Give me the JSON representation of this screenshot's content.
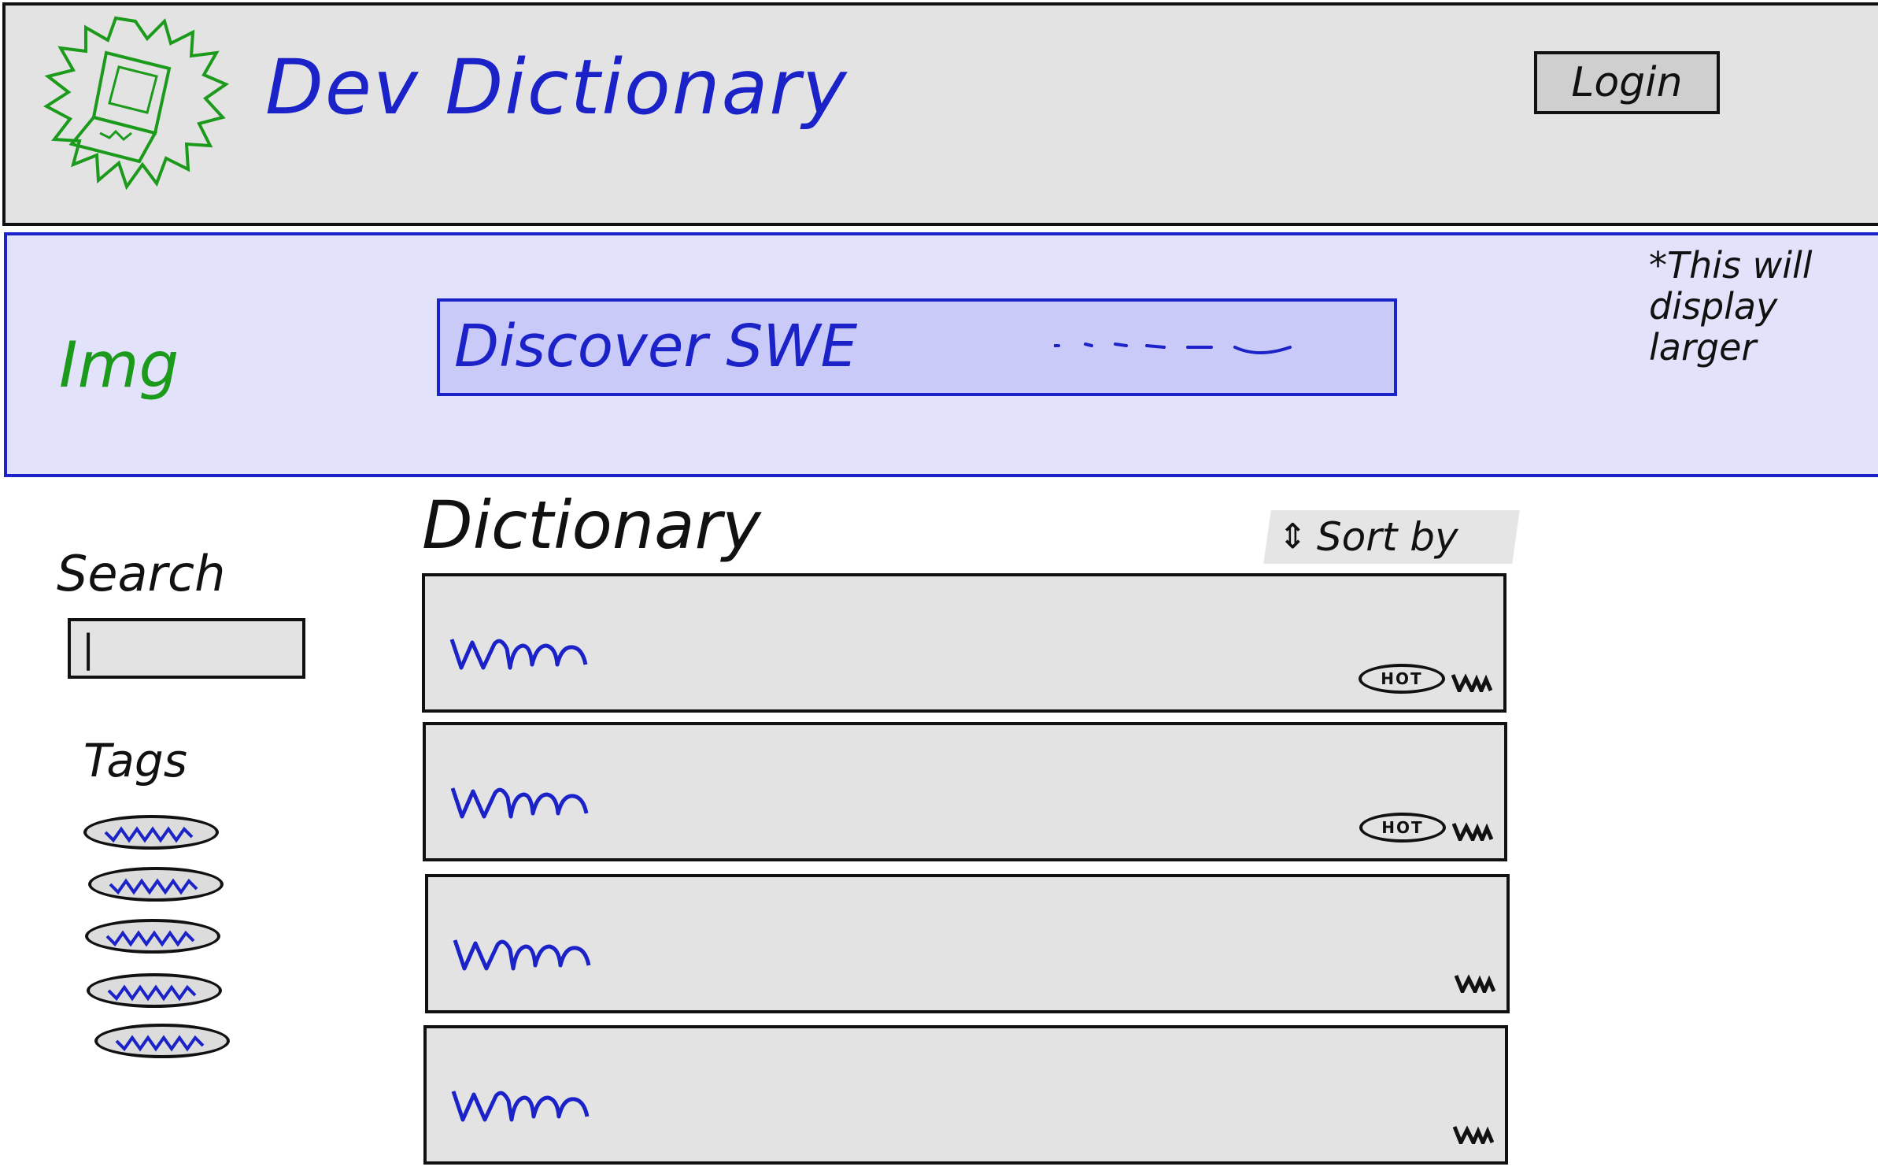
{
  "header": {
    "title": "Dev Dictionary",
    "login_label": "Login"
  },
  "banner": {
    "image_placeholder": "Img",
    "search_text": "Discover SWE",
    "note": "*This will display larger"
  },
  "sidebar": {
    "search_label": "Search",
    "search_value": "|",
    "tags_label": "Tags",
    "tag_count": 5
  },
  "main": {
    "title": "Dictionary",
    "sort_label": "Sort by",
    "entries": [
      {
        "hot": true,
        "badge": "HOT"
      },
      {
        "hot": true,
        "badge": "HOT"
      },
      {
        "hot": false
      },
      {
        "hot": false
      }
    ]
  },
  "colors": {
    "accent_blue": "#1a22c8",
    "logo_green": "#1b9a1b",
    "panel_gray": "#e3e3e3",
    "banner_fill": "#e2e2fb",
    "banner_search_fill": "#cacaf9"
  },
  "icons": {
    "logo": "laptop-logo-icon",
    "sort": "sort-arrows-icon"
  }
}
